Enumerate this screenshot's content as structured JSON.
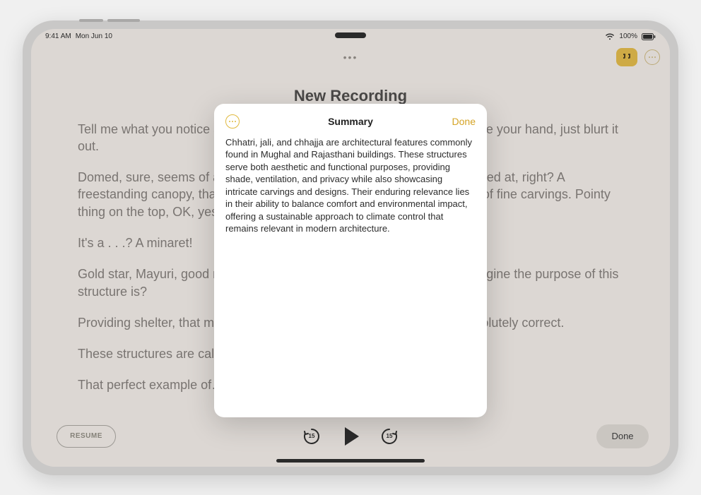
{
  "status": {
    "time": "9:41 AM",
    "date": "Mon Jun 10",
    "battery": "100%"
  },
  "document": {
    "title": "New Recording"
  },
  "transcript": {
    "p1": "Tell me what you notice about the shape of it? And you don't need to raise your hand, just blurt it out.",
    "p2": "Domed, sure, seems of a piece with a lot of other architecture we've looked at, right? A freestanding canopy, that's right. Carvings, yes, there's evidently a form of fine carvings. Pointy thing on the top, OK, yes, do you remember what those are called?",
    "p3": "It's a . . .? A minaret!",
    "p4": "Gold star, Mayuri, good remembering. So given its form, can anyone imagine the purpose of this structure is?",
    "p5": "Providing shelter, that makes sense, anything else? Shade, you are absolutely correct.",
    "p6": "These structures are called chhatri.",
    "p7": "That perfect example of…"
  },
  "playback": {
    "resume": "RESUME",
    "done": "Done",
    "skip_amount": "15"
  },
  "modal": {
    "title": "Summary",
    "done": "Done",
    "body": "Chhatri, jali, and chhajja are architectural features commonly found in Mughal and Rajasthani buildings. These structures serve both aesthetic and functional purposes, providing shade, ventilation, and privacy while also showcasing intricate carvings and designs. Their enduring relevance lies in their ability to balance comfort and environmental impact, offering a sustainable approach to climate control that remains relevant in modern architecture."
  }
}
